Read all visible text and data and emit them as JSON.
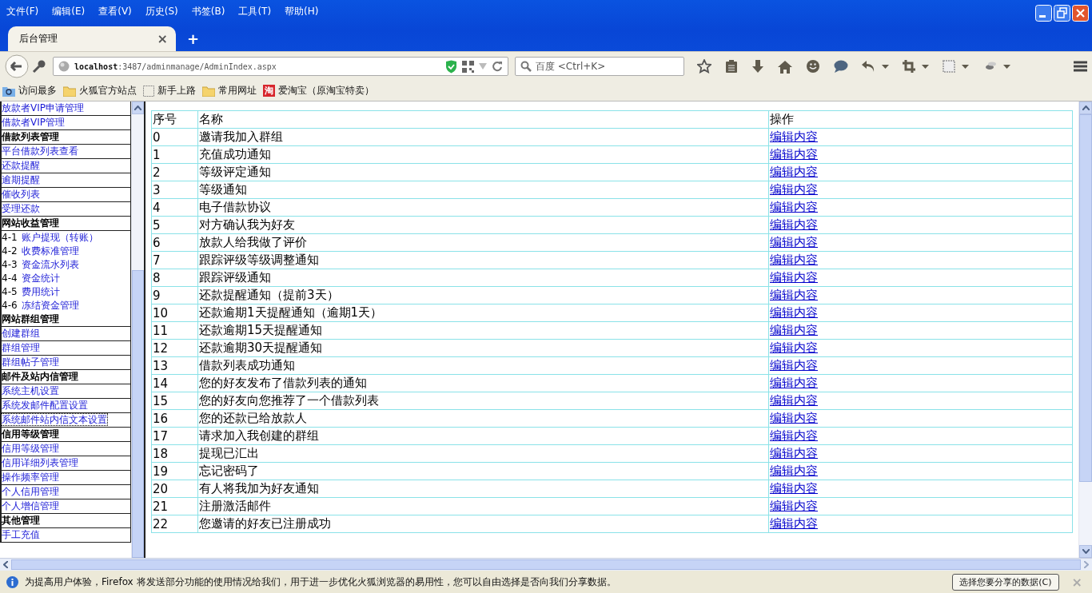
{
  "menu_bar": [
    "文件(F)",
    "编辑(E)",
    "查看(V)",
    "历史(S)",
    "书签(B)",
    "工具(T)",
    "帮助(H)"
  ],
  "tabs": [
    {
      "label": "后台管理",
      "selected": true,
      "close": "×"
    }
  ],
  "new_tab": "+",
  "address_bar": {
    "url": "**localhost**:3487/adminmanage/AdminIndex.aspx"
  },
  "search": {
    "placeholder": "百度 <Ctrl+K>"
  },
  "bookmarks": [
    {
      "kind": "search-folder",
      "label": "访问最多"
    },
    {
      "kind": "folder",
      "label": "火狐官方站点"
    },
    {
      "kind": "dashed",
      "label": "新手上路"
    },
    {
      "kind": "folder",
      "label": "常用网址"
    },
    {
      "kind": "badge",
      "badge": "淘",
      "label": "爱淘宝（原淘宝特卖）"
    }
  ],
  "sidebar": {
    "items": [
      {
        "kind": "link",
        "label": "放款者VIP申请管理",
        "focused": false
      },
      {
        "kind": "link",
        "label": "借款者VIP管理",
        "focused": false
      },
      {
        "kind": "header",
        "label": "借款列表管理"
      },
      {
        "kind": "link",
        "label": "平台借款列表查看",
        "focused": false
      },
      {
        "kind": "link",
        "label": "还款提醒",
        "focused": false
      },
      {
        "kind": "link",
        "label": "逾期提醒",
        "focused": false
      },
      {
        "kind": "link",
        "label": "催收列表",
        "focused": false
      },
      {
        "kind": "link",
        "label": "受理还款",
        "focused": false
      },
      {
        "kind": "header",
        "label": "网站收益管理"
      },
      {
        "kind": "sublink",
        "prefix": "4-1",
        "label": "账户提现（转账）",
        "focused": false
      },
      {
        "kind": "sublink",
        "prefix": "4-2",
        "label": "收费标准管理",
        "focused": false
      },
      {
        "kind": "sublink",
        "prefix": "4-3",
        "label": "资金流水列表",
        "focused": false
      },
      {
        "kind": "sublink",
        "prefix": "4-4",
        "label": "资金统计",
        "focused": false
      },
      {
        "kind": "sublink",
        "prefix": "4-5",
        "label": "费用统计",
        "focused": false
      },
      {
        "kind": "sublink",
        "prefix": "4-6",
        "label": "冻结资金管理",
        "focused": false
      },
      {
        "kind": "header",
        "label": "网站群组管理"
      },
      {
        "kind": "link",
        "label": "创建群组",
        "focused": false
      },
      {
        "kind": "link",
        "label": "群组管理",
        "focused": false
      },
      {
        "kind": "link",
        "label": "群组帖子管理",
        "focused": false
      },
      {
        "kind": "header",
        "label": "邮件及站内信管理"
      },
      {
        "kind": "link",
        "label": "系统主机设置",
        "focused": false
      },
      {
        "kind": "link",
        "label": "系统发邮件配置设置",
        "focused": false
      },
      {
        "kind": "link",
        "label": "系统邮件站内信文本设置",
        "focused": true
      },
      {
        "kind": "header",
        "label": "信用等级管理"
      },
      {
        "kind": "link",
        "label": "信用等级管理",
        "focused": false
      },
      {
        "kind": "link",
        "label": "信用详细列表管理",
        "focused": false
      },
      {
        "kind": "link",
        "label": "操作频率管理",
        "focused": false
      },
      {
        "kind": "link",
        "label": "个人信用管理",
        "focused": false
      },
      {
        "kind": "link",
        "label": "个人增信管理",
        "focused": false
      },
      {
        "kind": "header",
        "label": "其他管理"
      },
      {
        "kind": "link",
        "label": "手工充值",
        "focused": false
      }
    ]
  },
  "table": {
    "columns": [
      "序号",
      "名称",
      "操作"
    ],
    "rows": [
      [
        "0",
        "邀请我加入群组",
        "编辑内容"
      ],
      [
        "1",
        "充值成功通知",
        "编辑内容"
      ],
      [
        "2",
        "等级评定通知",
        "编辑内容"
      ],
      [
        "3",
        "等级通知",
        "编辑内容"
      ],
      [
        "4",
        "电子借款协议",
        "编辑内容"
      ],
      [
        "5",
        "对方确认我为好友",
        "编辑内容"
      ],
      [
        "6",
        "放款人给我做了评价",
        "编辑内容"
      ],
      [
        "7",
        "跟踪评级等级调整通知",
        "编辑内容"
      ],
      [
        "8",
        "跟踪评级通知",
        "编辑内容"
      ],
      [
        "9",
        "还款提醒通知（提前3天）",
        "编辑内容"
      ],
      [
        "10",
        "还款逾期1天提醒通知（逾期1天）",
        "编辑内容"
      ],
      [
        "11",
        "还款逾期15天提醒通知",
        "编辑内容"
      ],
      [
        "12",
        "还款逾期30天提醒通知",
        "编辑内容"
      ],
      [
        "13",
        "借款列表成功通知",
        "编辑内容"
      ],
      [
        "14",
        "您的好友发布了借款列表的通知",
        "编辑内容"
      ],
      [
        "15",
        "您的好友向您推荐了一个借款列表",
        "编辑内容"
      ],
      [
        "16",
        "您的还款已给放款人",
        "编辑内容"
      ],
      [
        "17",
        "请求加入我创建的群组",
        "编辑内容"
      ],
      [
        "18",
        "提现已汇出",
        "编辑内容"
      ],
      [
        "19",
        "忘记密码了",
        "编辑内容"
      ],
      [
        "20",
        "有人将我加为好友通知",
        "编辑内容"
      ],
      [
        "21",
        "注册激活邮件",
        "编辑内容"
      ],
      [
        "22",
        "您邀请的好友已注册成功",
        "编辑内容"
      ]
    ]
  },
  "notification": {
    "message": "为提高用户体验，Firefox 将发送部分功能的使用情况给我们，用于进一步优化火狐浏览器的易用性，您可以自由选择是否向我们分享数据。",
    "button": "选择您要分享的数据(C)",
    "close": "×"
  }
}
